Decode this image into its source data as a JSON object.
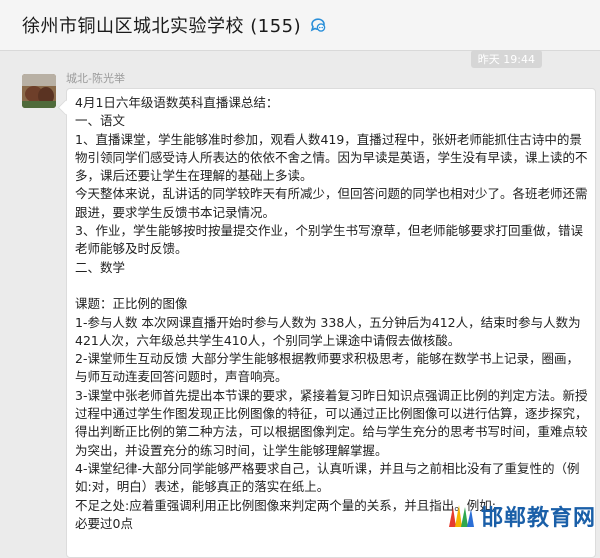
{
  "header": {
    "title": "徐州市铜山区城北实验学校 (155)"
  },
  "timestamp": "昨天 19:44",
  "message": {
    "sender": "城北-陈光举",
    "lines": [
      "4月1日六年级语数英科直播课总结：",
      "一、语文",
      "1、直播课堂，学生能够准时参加，观看人数419，直播过程中，张妍老师能抓住古诗中的景物引领同学们感受诗人所表达的依依不舍之情。因为早读是英语，学生没有早读，课上读的不多，课后还要让学生在理解的基础上多读。",
      "今天整体来说，乱讲话的同学较昨天有所减少，但回答问题的同学也相对少了。各班老师还需跟进，要求学生反馈书本记录情况。",
      "3、作业，学生能够按时按量提交作业，个别学生书写潦草，但老师能够要求打回重做，错误老师能够及时反馈。",
      "二、数学",
      "",
      "课题：正比例的图像",
      "1-参与人数  本次网课直播开始时参与人数为  338人，五分钟后为412人，结束时参与人数为421人次，六年级总共学生410人，个别同学上课途中请假去做核酸。",
      "2-课堂师生互动反馈  大部分学生能够根据教师要求积极思考，能够在数学书上记录，圈画，与师互动连麦回答问题时，声音响亮。",
      "3-课堂中张老师首先提出本节课的要求，紧接着复习昨日知识点强调正比例的判定方法。新授过程中通过学生作图发现正比例图像的特征，可以通过正比例图像可以进行估算，逐步探究，得出判断正比例的第二种方法，可以根据图像判定。给与学生充分的思考书写时间，重难点较为突出，并设置充分的练习时间，让学生能够理解掌握。",
      "4-课堂纪律-大部分同学能够严格要求自己，认真听课，并且与之前相比没有了重复性的（例如:对，明白）表述，能够真正的落实在纸上。",
      "不足之处:应着重强调利用正比例图像来判定两个量的关系，并且指出。例如:",
      "必要过0点"
    ]
  },
  "watermark": {
    "text": "邯郸教育网",
    "icon": "pencils-logo-icon"
  },
  "colors": {
    "background": "#ebebeb",
    "bubble": "#ffffff",
    "watermark": "#1a5fa8"
  }
}
